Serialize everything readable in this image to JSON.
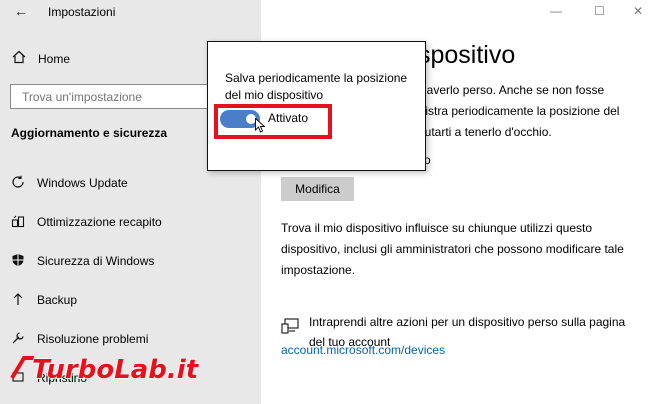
{
  "window": {
    "title": "Impostazioni",
    "controls": {
      "minimize": "—",
      "maximize": "☐",
      "close": "✕"
    }
  },
  "sidebar": {
    "home_label": "Home",
    "search_placeholder": "Trova un'impostazione",
    "section_title": "Aggiornamento e sicurezza",
    "items": [
      {
        "label": "Windows Update",
        "icon": "refresh-icon"
      },
      {
        "label": "Ottimizzazione recapito",
        "icon": "delivery-icon"
      },
      {
        "label": "Sicurezza di Windows",
        "icon": "shield-icon"
      },
      {
        "label": "Backup",
        "icon": "upload-arrow-icon"
      },
      {
        "label": "Risoluzione problemi",
        "icon": "wrench-icon"
      },
      {
        "label": "Ripristino",
        "icon": "recovery-icon"
      }
    ]
  },
  "main": {
    "title_fragment": "spositivo",
    "para1_lines": [
      "i di averlo perso. Anche se non fosse",
      "registra periodicamente la posizione del",
      "r aiutarti a tenerlo d'occhio."
    ],
    "status_fragment": "rato",
    "modify_button": "Modifica",
    "para2": "Trova il mio dispositivo influisce su chiunque utilizzi questo dispositivo, inclusi gli amministratori che possono modificare tale impostazione.",
    "action_text": "Intraprendi altre azioni per un dispositivo perso sulla pagina del tuo account",
    "action_link": "account.microsoft.com/devices"
  },
  "flyout": {
    "description": "Salva periodicamente la posizione del mio dispositivo",
    "toggle_label": "Attivato",
    "toggle_on": true
  },
  "colors": {
    "accent": "#4a7ec9",
    "highlight": "#e5121d",
    "link": "#0063b1",
    "sidebar_bg": "#e8e8e8"
  },
  "watermark": {
    "text": "TurboLab.it"
  }
}
